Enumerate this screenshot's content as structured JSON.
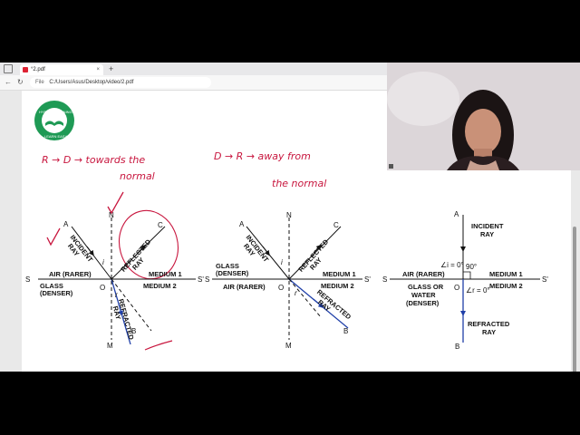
{
  "browser": {
    "tab_title": "°2.pdf",
    "tab_close": "×",
    "new_tab": "+",
    "url_label": "File",
    "url": "C:/Users/Asus/Desktop/video/2.pdf",
    "nav_back": "←",
    "nav_reload": "↻"
  },
  "logo": {
    "text_top": "HYBRID LEARNING",
    "text_bottom": "LEARN EASY",
    "color": "#1f9a55"
  },
  "handwriting": {
    "note_left_1": "R → D → towards the",
    "note_left_2": "normal",
    "note_right_1": "D → R → away from",
    "note_right_2": "the normal",
    "ink_color": "#c8163e"
  },
  "diagram1": {
    "A": "A",
    "N": "N",
    "C": "C",
    "S": "S",
    "S_prime": "S'",
    "O": "O",
    "M": "M",
    "B": "B",
    "incident": [
      "INCIDENT",
      "RAY"
    ],
    "reflected": [
      "REFLECTED",
      "RAY"
    ],
    "refracted": [
      "REFRACTED",
      "RAY"
    ],
    "air": "AIR (RARER)",
    "glass": [
      "GLASS",
      "(DENSER)"
    ],
    "medium1": "MEDIUM 1",
    "medium2": "MEDIUM 2",
    "i": "i",
    "r": "r"
  },
  "diagram2": {
    "A": "A",
    "N": "N",
    "C": "C",
    "S": "S",
    "S_prime": "S'",
    "O": "O",
    "M": "M",
    "B": "B",
    "incident": [
      "INCIDENT",
      "RAY"
    ],
    "reflected": [
      "REFLECTED",
      "RAY"
    ],
    "refracted": [
      "REFRACTED",
      "RAY"
    ],
    "glass": [
      "GLASS",
      "(DENSER)"
    ],
    "air": "AIR (RARER)",
    "medium1": "MEDIUM 1",
    "medium2": "MEDIUM 2",
    "i": "i",
    "r": "r"
  },
  "diagram3": {
    "A": "A",
    "S": "S",
    "S_prime": "S'",
    "O": "O",
    "B": "B",
    "incident": [
      "INCIDENT",
      "RAY"
    ],
    "angle_i": "∠i = 0°",
    "angle_r": "∠r = 0°",
    "right_angle": "90°",
    "air": "AIR (RARER)",
    "glass": [
      "GLASS OR",
      "WATER",
      "(DENSER)"
    ],
    "medium1": "MEDIUM 1",
    "medium2": "MEDIUM 2",
    "refracted": [
      "REFRACTED",
      "RAY"
    ]
  },
  "colors": {
    "ray_blue": "#1f3fa8"
  }
}
